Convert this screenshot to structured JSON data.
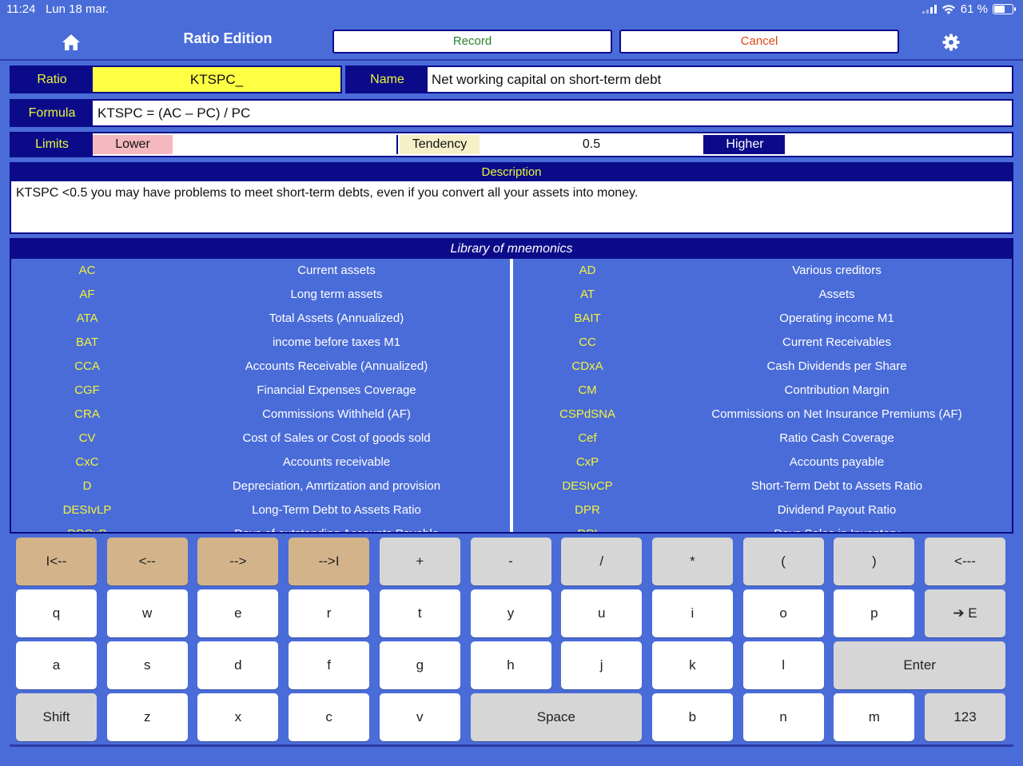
{
  "status_bar": {
    "time": "11:24",
    "date": "Lun 18 mar.",
    "battery": "61 %",
    "battery_level": 0.61
  },
  "nav": {
    "title": "Ratio Edition",
    "record_label": "Record",
    "cancel_label": "Cancel",
    "home_icon": "home-icon",
    "settings_icon": "gear-icon"
  },
  "fields": {
    "ratio_label": "Ratio",
    "ratio_value": "KTSPC_",
    "name_label": "Name",
    "name_value": "Net working capital on short-term debt",
    "formula_label": "Formula",
    "formula_value": "KTSPC = (AC – PC) / PC",
    "limits_label": "Limits",
    "lower_label": "Lower",
    "tendency_label": "Tendency",
    "tendency_value": "0.5",
    "higher_label": "Higher"
  },
  "description": {
    "header": "Description",
    "text": "KTSPC <0.5 you may have problems to meet short-term debts, even if you convert all your assets into money."
  },
  "library": {
    "header": "Library of mnemonics",
    "left": [
      {
        "code": "AC",
        "desc": "Current assets"
      },
      {
        "code": "AF",
        "desc": "Long term assets"
      },
      {
        "code": "ATA",
        "desc": "Total Assets (Annualized)"
      },
      {
        "code": "BAT",
        "desc": "income before taxes M1"
      },
      {
        "code": "CCA",
        "desc": "Accounts Receivable (Annualized)"
      },
      {
        "code": "CGF",
        "desc": "Financial Expenses Coverage"
      },
      {
        "code": "CRA",
        "desc": "Commissions Withheld (AF)"
      },
      {
        "code": "CV",
        "desc": "Cost of Sales or Cost of goods sold"
      },
      {
        "code": "CxC",
        "desc": "Accounts receivable"
      },
      {
        "code": "D",
        "desc": "Depreciation, Amrtization and provision"
      },
      {
        "code": "DESIvLP",
        "desc": "Long-Term Debt to Assets Ratio"
      },
      {
        "code": "DPCxP",
        "desc": "Days of outstanding Accounts Payable"
      }
    ],
    "right": [
      {
        "code": "AD",
        "desc": "Various creditors"
      },
      {
        "code": "AT",
        "desc": "Assets"
      },
      {
        "code": "BAIT",
        "desc": "Operating income M1"
      },
      {
        "code": "CC",
        "desc": "Current Receivables"
      },
      {
        "code": "CDxA",
        "desc": "Cash Dividends per Share"
      },
      {
        "code": "CM",
        "desc": "Contribution Margin"
      },
      {
        "code": "CSPdSNA",
        "desc": "Commissions on Net Insurance Premiums (AF)"
      },
      {
        "code": "Cef",
        "desc": "Ratio Cash Coverage"
      },
      {
        "code": "CxP",
        "desc": "Accounts payable"
      },
      {
        "code": "DESIvCP",
        "desc": "Short-Term Debt to Assets Ratio"
      },
      {
        "code": "DPR",
        "desc": "Dividend Payout Ratio"
      },
      {
        "code": "DPI",
        "desc": "Days Sales in Inventory"
      }
    ]
  },
  "keyboard": {
    "rows": [
      [
        {
          "label": "I<--",
          "style": "nav",
          "name": "key-home"
        },
        {
          "label": "<--",
          "style": "nav",
          "name": "key-left"
        },
        {
          "label": "-->",
          "style": "nav",
          "name": "key-right"
        },
        {
          "label": "-->I",
          "style": "nav",
          "name": "key-end"
        },
        {
          "label": "+",
          "style": "gray",
          "name": "key-plus"
        },
        {
          "label": "-",
          "style": "gray",
          "name": "key-minus"
        },
        {
          "label": "/",
          "style": "gray",
          "name": "key-divide"
        },
        {
          "label": "*",
          "style": "gray",
          "name": "key-multiply"
        },
        {
          "label": "(",
          "style": "gray",
          "name": "key-open-paren"
        },
        {
          "label": ")",
          "style": "gray",
          "name": "key-close-paren"
        },
        {
          "label": "<---",
          "style": "gray",
          "name": "key-backspace"
        }
      ],
      [
        {
          "label": "q",
          "style": "white",
          "name": "key-q"
        },
        {
          "label": "w",
          "style": "white",
          "name": "key-w"
        },
        {
          "label": "e",
          "style": "white",
          "name": "key-e"
        },
        {
          "label": "r",
          "style": "white",
          "name": "key-r"
        },
        {
          "label": "t",
          "style": "white",
          "name": "key-t"
        },
        {
          "label": "y",
          "style": "white",
          "name": "key-y"
        },
        {
          "label": "u",
          "style": "white",
          "name": "key-u"
        },
        {
          "label": "i",
          "style": "white",
          "name": "key-i"
        },
        {
          "label": "o",
          "style": "white",
          "name": "key-o"
        },
        {
          "label": "p",
          "style": "white",
          "name": "key-p"
        },
        {
          "label": "➔ E",
          "style": "gray",
          "name": "key-next-field"
        }
      ],
      [
        {
          "label": "a",
          "style": "white",
          "name": "key-a"
        },
        {
          "label": "s",
          "style": "white",
          "name": "key-s"
        },
        {
          "label": "d",
          "style": "white",
          "name": "key-d"
        },
        {
          "label": "f",
          "style": "white",
          "name": "key-f"
        },
        {
          "label": "g",
          "style": "white",
          "name": "key-g"
        },
        {
          "label": "h",
          "style": "white",
          "name": "key-h"
        },
        {
          "label": "j",
          "style": "white",
          "name": "key-j"
        },
        {
          "label": "k",
          "style": "white",
          "name": "key-k"
        },
        {
          "label": "l",
          "style": "white",
          "name": "key-l"
        },
        {
          "label": "Enter",
          "style": "gray",
          "name": "key-enter",
          "span": 2
        }
      ],
      [
        {
          "label": "Shift",
          "style": "gray",
          "name": "key-shift"
        },
        {
          "label": "z",
          "style": "white",
          "name": "key-z"
        },
        {
          "label": "x",
          "style": "white",
          "name": "key-x"
        },
        {
          "label": "c",
          "style": "white",
          "name": "key-c"
        },
        {
          "label": "v",
          "style": "white",
          "name": "key-v"
        },
        {
          "label": "Space",
          "style": "gray",
          "name": "key-space",
          "span": 2
        },
        {
          "label": "b",
          "style": "white",
          "name": "key-b"
        },
        {
          "label": "n",
          "style": "white",
          "name": "key-n"
        },
        {
          "label": "m",
          "style": "white",
          "name": "key-m"
        },
        {
          "label": "123",
          "style": "gray",
          "name": "key-123"
        }
      ]
    ]
  },
  "colors": {
    "background": "#4a6cd8",
    "label_bg": "#0b0b8a",
    "label_text": "#e9f53a",
    "ratio_field": "#ffff44",
    "lower_bg": "#f5b8c0",
    "tendency_bg": "#f5f0c8",
    "key_nav": "#d3b48a"
  }
}
